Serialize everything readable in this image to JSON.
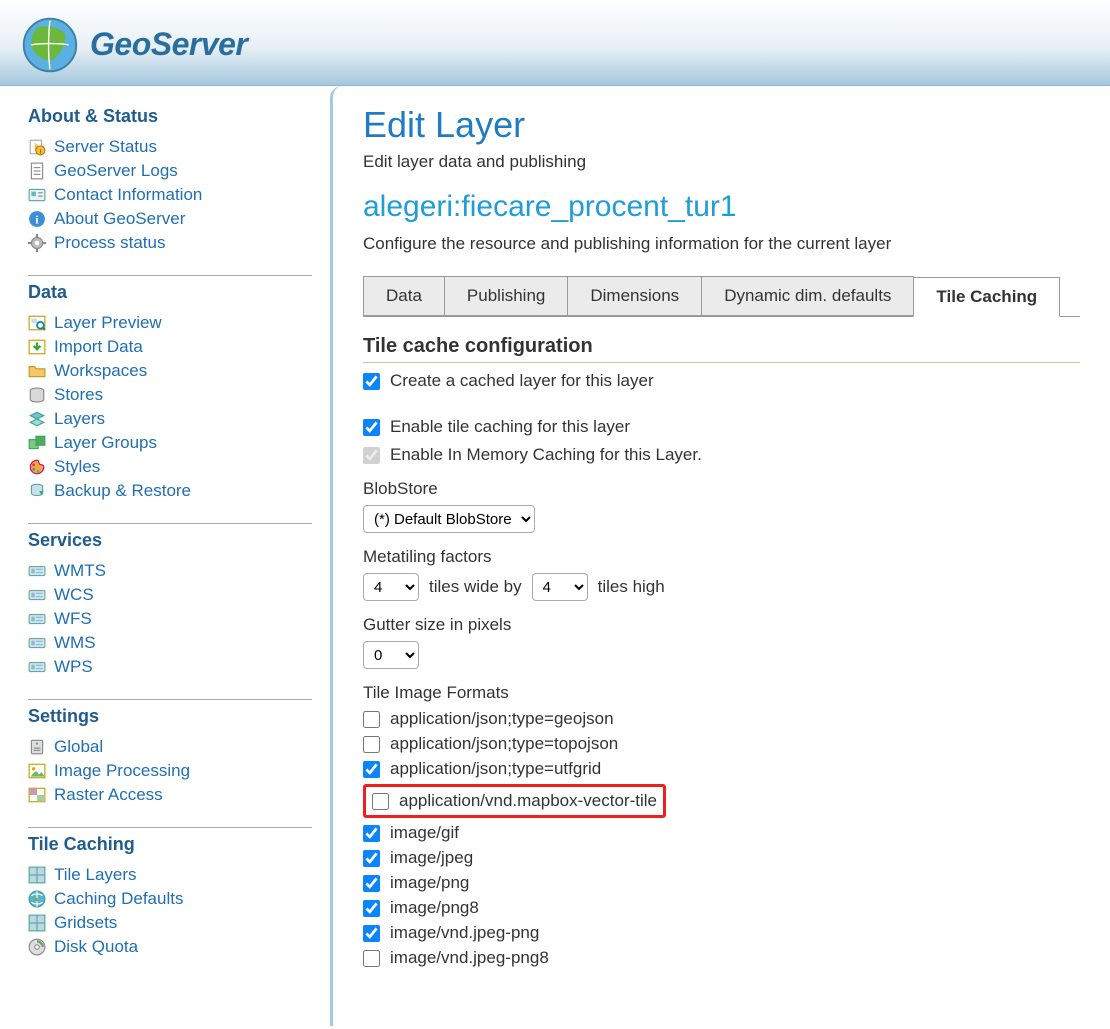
{
  "brand": {
    "name": "GeoServer"
  },
  "sidebar": {
    "sections": [
      {
        "title": "About & Status",
        "items": [
          {
            "label": "Server Status",
            "icon": "flag"
          },
          {
            "label": "GeoServer Logs",
            "icon": "doc"
          },
          {
            "label": "Contact Information",
            "icon": "card"
          },
          {
            "label": "About GeoServer",
            "icon": "info"
          },
          {
            "label": "Process status",
            "icon": "gear"
          }
        ]
      },
      {
        "title": "Data",
        "items": [
          {
            "label": "Layer Preview",
            "icon": "preview"
          },
          {
            "label": "Import Data",
            "icon": "import"
          },
          {
            "label": "Workspaces",
            "icon": "folder"
          },
          {
            "label": "Stores",
            "icon": "db"
          },
          {
            "label": "Layers",
            "icon": "layers"
          },
          {
            "label": "Layer Groups",
            "icon": "groups"
          },
          {
            "label": "Styles",
            "icon": "palette"
          },
          {
            "label": "Backup & Restore",
            "icon": "backup"
          }
        ]
      },
      {
        "title": "Services",
        "items": [
          {
            "label": "WMTS",
            "icon": "service"
          },
          {
            "label": "WCS",
            "icon": "service"
          },
          {
            "label": "WFS",
            "icon": "service"
          },
          {
            "label": "WMS",
            "icon": "service"
          },
          {
            "label": "WPS",
            "icon": "service"
          }
        ]
      },
      {
        "title": "Settings",
        "items": [
          {
            "label": "Global",
            "icon": "server"
          },
          {
            "label": "Image Processing",
            "icon": "image"
          },
          {
            "label": "Raster Access",
            "icon": "raster"
          }
        ]
      },
      {
        "title": "Tile Caching",
        "items": [
          {
            "label": "Tile Layers",
            "icon": "grid"
          },
          {
            "label": "Caching Defaults",
            "icon": "globe"
          },
          {
            "label": "Gridsets",
            "icon": "grid"
          },
          {
            "label": "Disk Quota",
            "icon": "disk"
          }
        ]
      }
    ]
  },
  "page": {
    "title": "Edit Layer",
    "description": "Edit layer data and publishing",
    "layer_name": "alegeri:fiecare_procent_tur1",
    "layer_desc": "Configure the resource and publishing information for the current layer"
  },
  "tabs": [
    "Data",
    "Publishing",
    "Dimensions",
    "Dynamic dim. defaults",
    "Tile Caching"
  ],
  "active_tab": "Tile Caching",
  "tile_config": {
    "section_title": "Tile cache configuration",
    "create_cached": {
      "label": "Create a cached layer for this layer",
      "checked": true
    },
    "enable_tile": {
      "label": "Enable tile caching for this layer",
      "checked": true
    },
    "enable_memory": {
      "label": "Enable In Memory Caching for this Layer.",
      "checked": true,
      "disabled": true
    },
    "blobstore": {
      "label": "BlobStore",
      "value": "(*) Default BlobStore"
    },
    "metatiling": {
      "label": "Metatiling factors",
      "wide": "4",
      "wide_suffix": "tiles wide by",
      "high": "4",
      "high_suffix": "tiles high"
    },
    "gutter": {
      "label": "Gutter size in pixels",
      "value": "0"
    },
    "formats": {
      "label": "Tile Image Formats",
      "items": [
        {
          "name": "application/json;type=geojson",
          "checked": false
        },
        {
          "name": "application/json;type=topojson",
          "checked": false
        },
        {
          "name": "application/json;type=utfgrid",
          "checked": true
        },
        {
          "name": "application/vnd.mapbox-vector-tile",
          "checked": false,
          "highlight": true
        },
        {
          "name": "image/gif",
          "checked": true
        },
        {
          "name": "image/jpeg",
          "checked": true
        },
        {
          "name": "image/png",
          "checked": true
        },
        {
          "name": "image/png8",
          "checked": true
        },
        {
          "name": "image/vnd.jpeg-png",
          "checked": true
        },
        {
          "name": "image/vnd.jpeg-png8",
          "checked": false
        }
      ]
    }
  }
}
